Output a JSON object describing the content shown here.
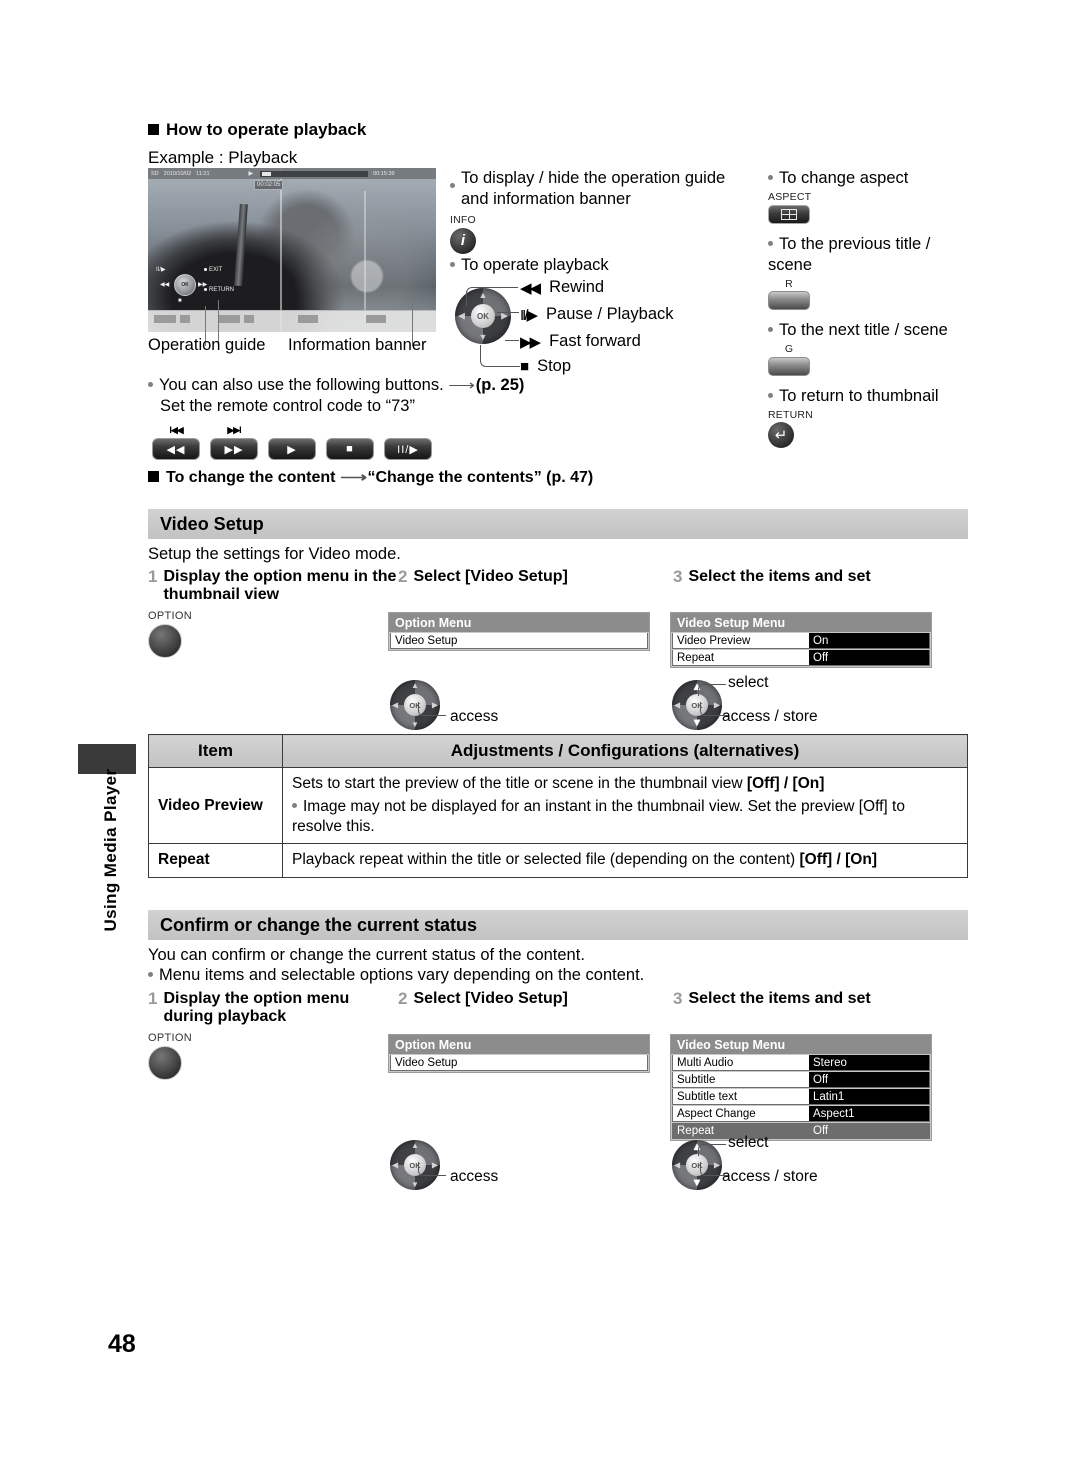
{
  "page": {
    "number": "48",
    "side_tab": "Using Media Player"
  },
  "top": {
    "heading": "How to operate playback",
    "example_label": "Example : Playback",
    "caption_operation_guide": "Operation guide",
    "caption_information_banner": "Information banner",
    "also_use_line1": "You can also use the following buttons.",
    "also_use_page": "(p. 25)",
    "also_use_line2": "Set the remote control code to “73”",
    "change_content_prefix": "To change the content",
    "change_content_ref": "“Change the contents” (p. 47)"
  },
  "tv": {
    "banner": {
      "source": "SD",
      "date": "2010/10/02",
      "time": "11:21",
      "play_icon": "▶",
      "current_time": "00:02:05",
      "total_time": "00:15:39"
    },
    "guide": {
      "pause_play": "II/▶",
      "rewind": "◀◀",
      "fast_forward": "▶▶",
      "stop": "■",
      "exit": "EXIT",
      "return": "RETURN",
      "ok": "OK"
    }
  },
  "legend_mid": {
    "info_item": "To display / hide the operation guide and information banner",
    "info_label": "INFO",
    "info_glyph": "i",
    "operate_item": "To operate playback",
    "rows": [
      {
        "glyph": "◀◀",
        "label": "Rewind"
      },
      {
        "glyph": "II/▶",
        "label": "Pause / Playback"
      },
      {
        "glyph": "▶▶",
        "label": "Fast forward"
      },
      {
        "glyph": "■",
        "label": "Stop"
      }
    ]
  },
  "legend_right": {
    "items": [
      {
        "text": "To change aspect",
        "button_label": "ASPECT",
        "button_type": "aspect"
      },
      {
        "text": "To the previous title / scene",
        "button_label": "R",
        "button_type": "plain"
      },
      {
        "text": "To the next title / scene",
        "button_label": "G",
        "button_type": "plain"
      },
      {
        "text": "To return to thumbnail",
        "button_label": "RETURN",
        "button_type": "return"
      }
    ]
  },
  "remote_buttons": [
    {
      "top": "I◀◀",
      "glyph": "◀◀"
    },
    {
      "top": "▶▶I",
      "glyph": "▶▶"
    },
    {
      "top": "",
      "glyph": "▶"
    },
    {
      "top": "",
      "glyph": "■"
    },
    {
      "top": "",
      "glyph": "II/▶"
    }
  ],
  "video_setup": {
    "title": "Video Setup",
    "description": "Setup the settings for Video mode.",
    "steps": [
      {
        "num": "1",
        "label": "Display the option menu in the thumbnail view"
      },
      {
        "num": "2",
        "label": "Select [Video Setup]"
      },
      {
        "num": "3",
        "label": "Select the items and set"
      }
    ],
    "option_button_label": "OPTION",
    "option_menu": {
      "title": "Option Menu",
      "rows": [
        {
          "key": "Video Setup",
          "value": ""
        }
      ]
    },
    "setup_menu": {
      "title": "Video Setup Menu",
      "rows": [
        {
          "key": "Video Preview",
          "value": "On"
        },
        {
          "key": "Repeat",
          "value": "Off"
        }
      ]
    },
    "callouts": {
      "access": "access",
      "select": "select",
      "access_store": "access / store"
    }
  },
  "table": {
    "headers": [
      "Item",
      "Adjustments / Configurations (alternatives)"
    ],
    "rows": [
      {
        "item": "Video Preview",
        "main": "Sets to start the preview of the title or scene in the thumbnail view",
        "main_alt": "[Off] / [On]",
        "note": "Image may not be displayed for an instant in the thumbnail view. Set the preview [Off] to resolve this."
      },
      {
        "item": "Repeat",
        "main": "Playback repeat within the title or selected file (depending on the content)",
        "main_alt": "[Off] / [On]",
        "note": ""
      }
    ]
  },
  "confirm": {
    "title": "Confirm or change the current status",
    "description": "You can confirm or change the current status of the content.",
    "note": "Menu items and selectable options vary depending on the content.",
    "steps": [
      {
        "num": "1",
        "label": "Display the option menu during playback"
      },
      {
        "num": "2",
        "label": "Select [Video Setup]"
      },
      {
        "num": "3",
        "label": "Select the items and set"
      }
    ],
    "option_button_label": "OPTION",
    "option_menu": {
      "title": "Option Menu",
      "rows": [
        {
          "key": "Video Setup",
          "value": ""
        }
      ]
    },
    "setup_menu": {
      "title": "Video Setup Menu",
      "rows": [
        {
          "key": "Multi Audio",
          "value": "Stereo"
        },
        {
          "key": "Subtitle",
          "value": "Off"
        },
        {
          "key": "Subtitle text",
          "value": "Latin1"
        },
        {
          "key": "Aspect Change",
          "value": "Aspect1"
        },
        {
          "key": "Repeat",
          "value": "Off"
        }
      ]
    },
    "callouts": {
      "access": "access",
      "select": "select",
      "access_store": "access / store"
    }
  }
}
